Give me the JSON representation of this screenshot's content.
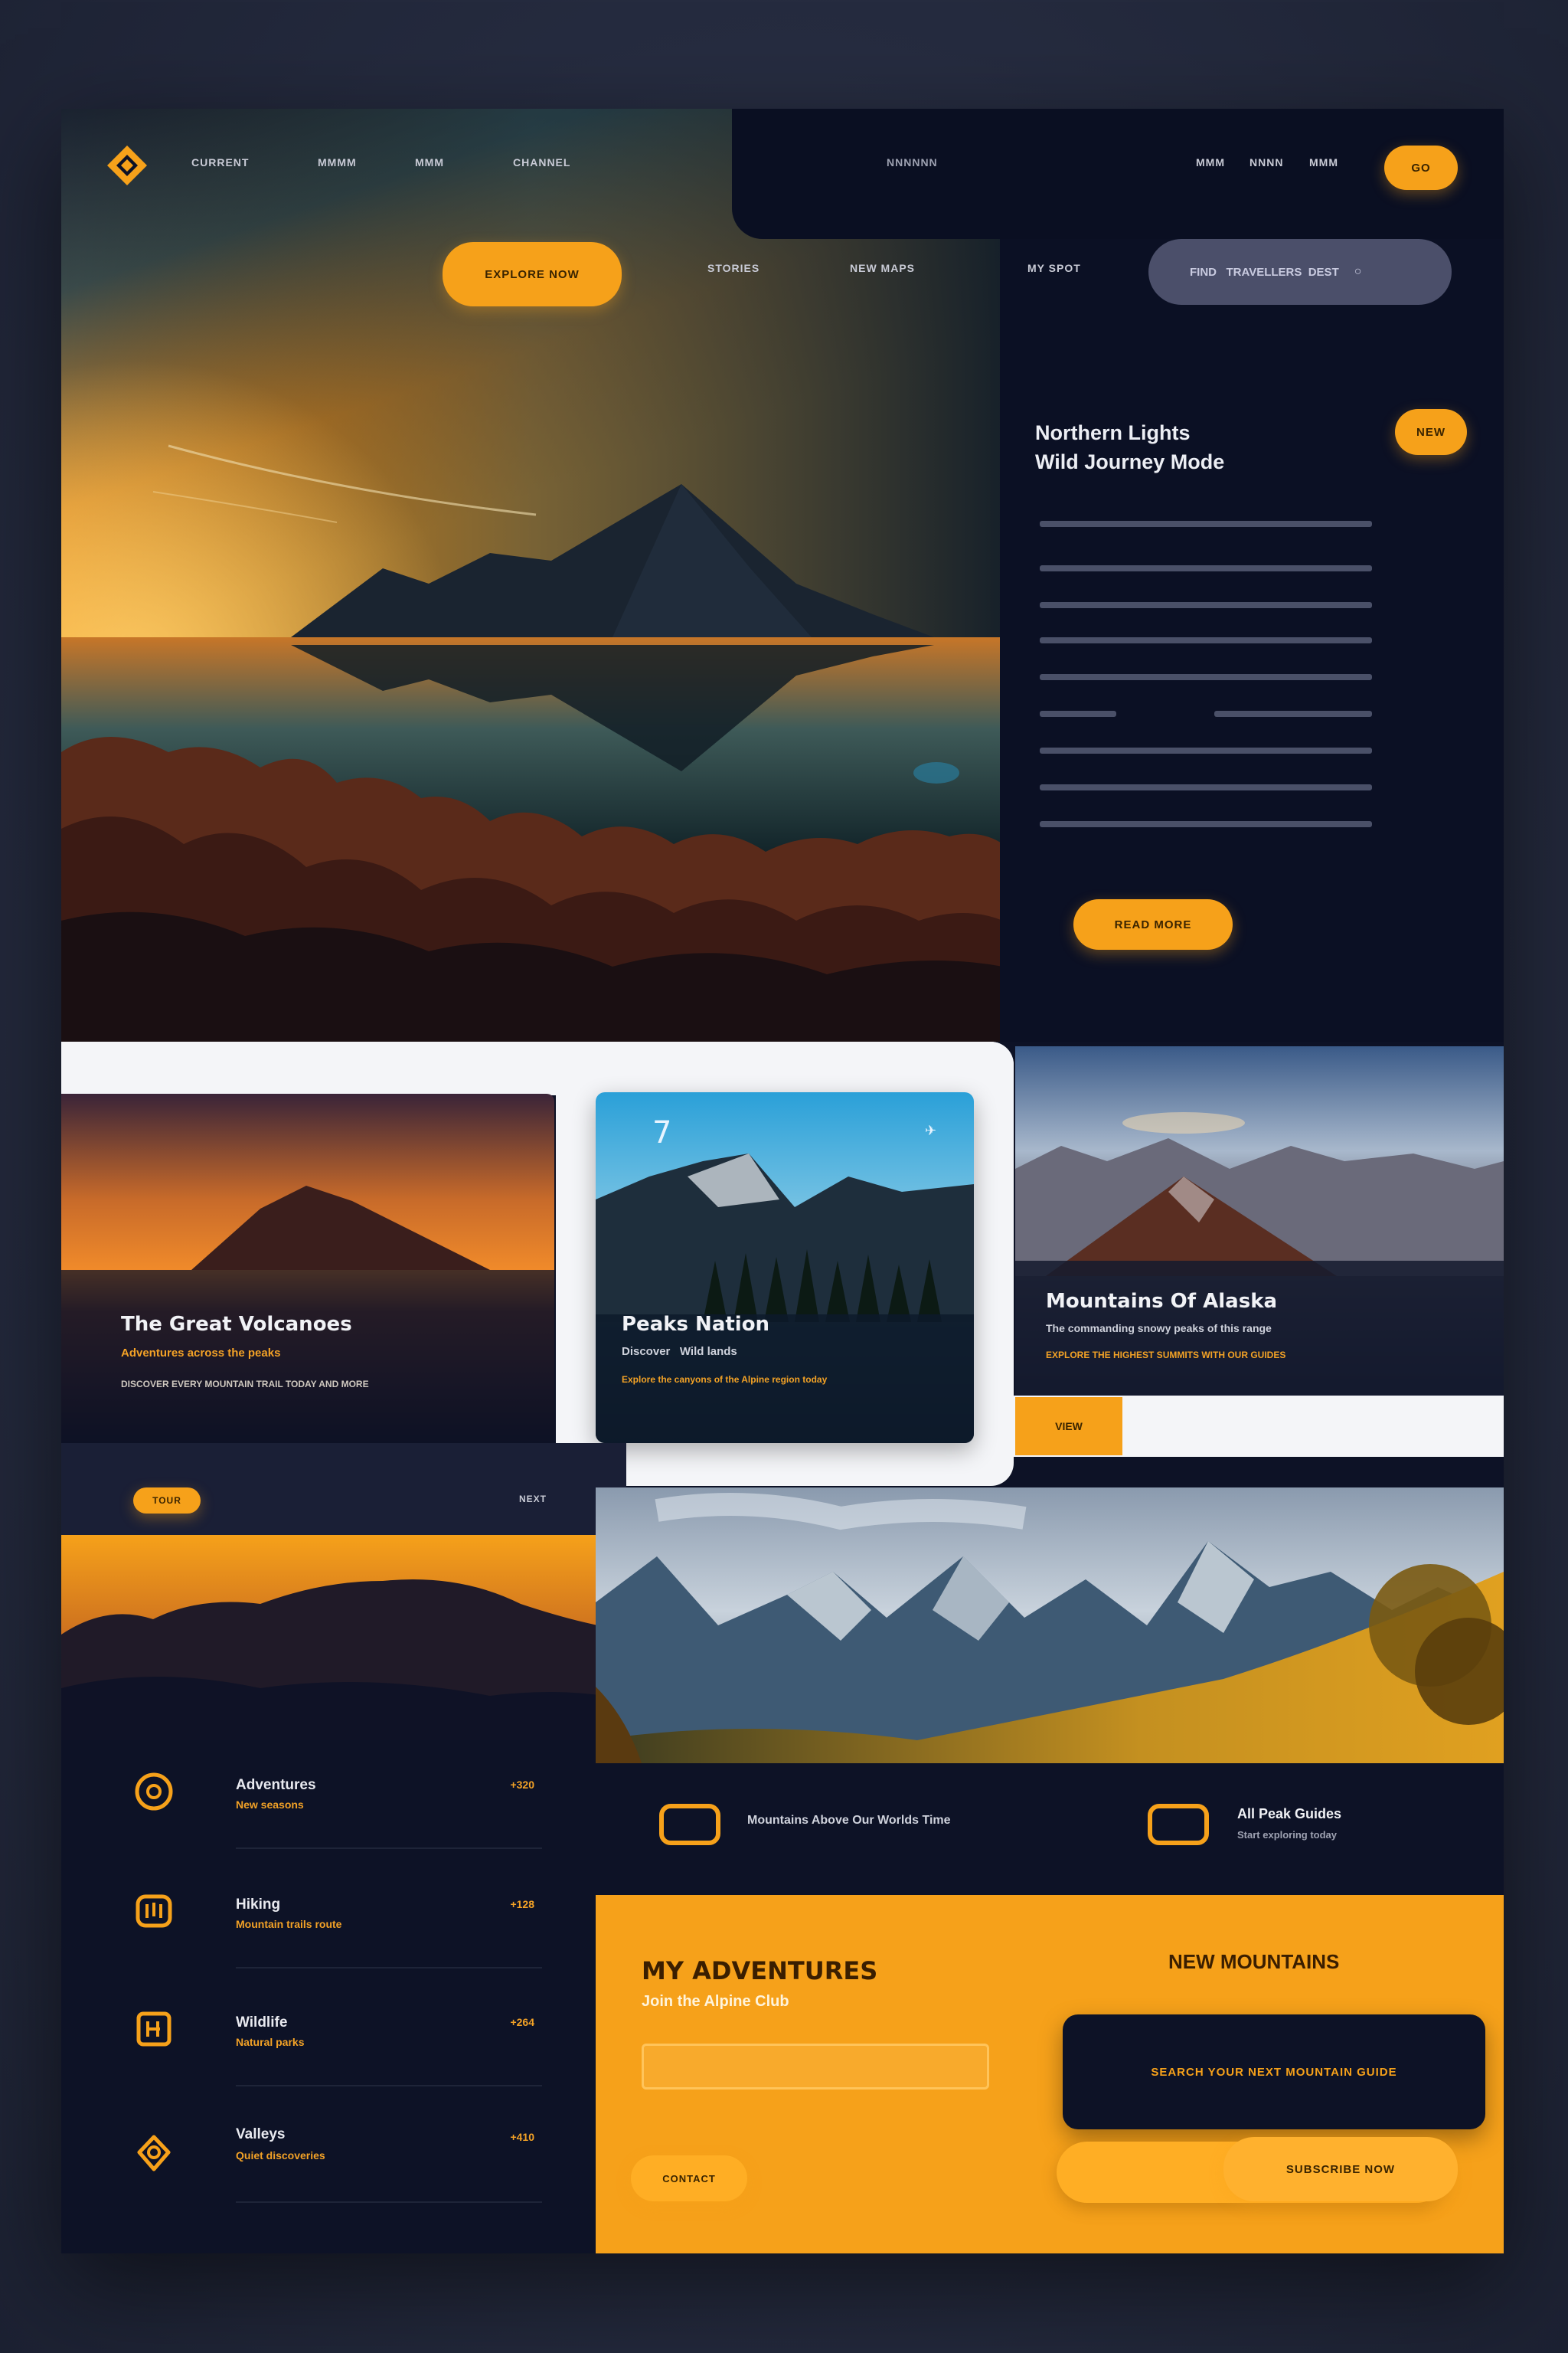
{
  "nav": {
    "links": [
      "CURRENT",
      "MMMM",
      "MMM",
      "CHANNEL"
    ],
    "center_label": "NNNNNN",
    "right_links": [
      "MMM",
      "NNNN",
      "MMM"
    ],
    "top_cta": "GO",
    "hero_cta": "EXPLORE NOW",
    "sub_links": [
      "STORIES",
      "NEW MAPS",
      "MY SPOT"
    ],
    "search_placeholder": "FIND   TRAVELLERS  DEST"
  },
  "hero_panel": {
    "title_line1": "Northern Lights",
    "title_line2": "Wild Journey Mode",
    "badge": "NEW",
    "cta": "READ MORE"
  },
  "cards": [
    {
      "title": "The Great Volcanoes",
      "sub": "Adventures across the peaks",
      "meta": "DISCOVER EVERY MOUNTAIN TRAIL TODAY AND MORE"
    },
    {
      "title": "Peaks Nation",
      "sub": "Discover   Wild lands",
      "meta": "Explore the canyons of the Alpine region today"
    },
    {
      "title": "Mountains Of Alaska",
      "sub": "The commanding snowy peaks of this range",
      "meta": "EXPLORE THE HIGHEST SUMMITS WITH OUR GUIDES"
    }
  ],
  "card_button": "VIEW",
  "strip": {
    "pill": "TOUR",
    "label": "NEXT"
  },
  "list": [
    {
      "title": "Adventures",
      "sub": "New seasons",
      "value": "+320"
    },
    {
      "title": "Hiking",
      "sub": "Mountain trails route",
      "value": "+128"
    },
    {
      "title": "Wildlife",
      "sub": "Natural parks",
      "value": "+264"
    },
    {
      "title": "Valleys",
      "sub": "Quiet discoveries",
      "value": "+410"
    }
  ],
  "features": [
    {
      "label": "Mountains Above Our Worlds Time"
    },
    {
      "label": "All Peak Guides",
      "sub": "Start exploring today"
    }
  ],
  "cta_section": {
    "title": "MY ADVENTURES",
    "subtitle": "Join the Alpine Club",
    "right_title": "NEW MOUNTAINS",
    "dark_button": "SEARCH YOUR NEXT MOUNTAIN GUIDE",
    "small_button": "CONTACT",
    "big_button": "SUBSCRIBE NOW"
  },
  "colors": {
    "accent": "#f6a11a",
    "panel": "#0d1226",
    "light": "#f4f5f8"
  },
  "icons": [
    "logo-diamond-icon",
    "compass-icon",
    "map-icon",
    "calendar-icon",
    "pin-icon",
    "frame-icon"
  ]
}
